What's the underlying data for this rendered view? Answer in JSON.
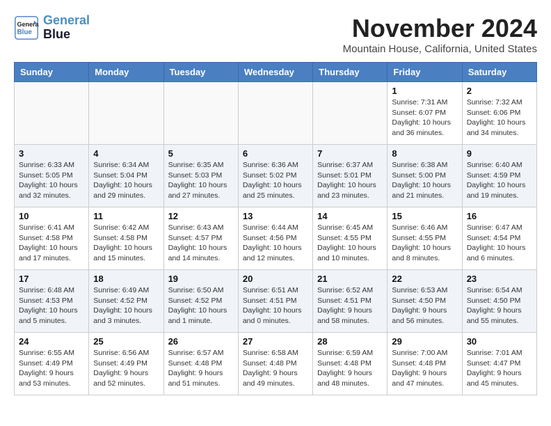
{
  "header": {
    "logo_line1": "General",
    "logo_line2": "Blue",
    "month_year": "November 2024",
    "location": "Mountain House, California, United States"
  },
  "weekdays": [
    "Sunday",
    "Monday",
    "Tuesday",
    "Wednesday",
    "Thursday",
    "Friday",
    "Saturday"
  ],
  "weeks": [
    [
      {
        "day": "",
        "detail": ""
      },
      {
        "day": "",
        "detail": ""
      },
      {
        "day": "",
        "detail": ""
      },
      {
        "day": "",
        "detail": ""
      },
      {
        "day": "",
        "detail": ""
      },
      {
        "day": "1",
        "detail": "Sunrise: 7:31 AM\nSunset: 6:07 PM\nDaylight: 10 hours and 36 minutes."
      },
      {
        "day": "2",
        "detail": "Sunrise: 7:32 AM\nSunset: 6:06 PM\nDaylight: 10 hours and 34 minutes."
      }
    ],
    [
      {
        "day": "3",
        "detail": "Sunrise: 6:33 AM\nSunset: 5:05 PM\nDaylight: 10 hours and 32 minutes."
      },
      {
        "day": "4",
        "detail": "Sunrise: 6:34 AM\nSunset: 5:04 PM\nDaylight: 10 hours and 29 minutes."
      },
      {
        "day": "5",
        "detail": "Sunrise: 6:35 AM\nSunset: 5:03 PM\nDaylight: 10 hours and 27 minutes."
      },
      {
        "day": "6",
        "detail": "Sunrise: 6:36 AM\nSunset: 5:02 PM\nDaylight: 10 hours and 25 minutes."
      },
      {
        "day": "7",
        "detail": "Sunrise: 6:37 AM\nSunset: 5:01 PM\nDaylight: 10 hours and 23 minutes."
      },
      {
        "day": "8",
        "detail": "Sunrise: 6:38 AM\nSunset: 5:00 PM\nDaylight: 10 hours and 21 minutes."
      },
      {
        "day": "9",
        "detail": "Sunrise: 6:40 AM\nSunset: 4:59 PM\nDaylight: 10 hours and 19 minutes."
      }
    ],
    [
      {
        "day": "10",
        "detail": "Sunrise: 6:41 AM\nSunset: 4:58 PM\nDaylight: 10 hours and 17 minutes."
      },
      {
        "day": "11",
        "detail": "Sunrise: 6:42 AM\nSunset: 4:58 PM\nDaylight: 10 hours and 15 minutes."
      },
      {
        "day": "12",
        "detail": "Sunrise: 6:43 AM\nSunset: 4:57 PM\nDaylight: 10 hours and 14 minutes."
      },
      {
        "day": "13",
        "detail": "Sunrise: 6:44 AM\nSunset: 4:56 PM\nDaylight: 10 hours and 12 minutes."
      },
      {
        "day": "14",
        "detail": "Sunrise: 6:45 AM\nSunset: 4:55 PM\nDaylight: 10 hours and 10 minutes."
      },
      {
        "day": "15",
        "detail": "Sunrise: 6:46 AM\nSunset: 4:55 PM\nDaylight: 10 hours and 8 minutes."
      },
      {
        "day": "16",
        "detail": "Sunrise: 6:47 AM\nSunset: 4:54 PM\nDaylight: 10 hours and 6 minutes."
      }
    ],
    [
      {
        "day": "17",
        "detail": "Sunrise: 6:48 AM\nSunset: 4:53 PM\nDaylight: 10 hours and 5 minutes."
      },
      {
        "day": "18",
        "detail": "Sunrise: 6:49 AM\nSunset: 4:52 PM\nDaylight: 10 hours and 3 minutes."
      },
      {
        "day": "19",
        "detail": "Sunrise: 6:50 AM\nSunset: 4:52 PM\nDaylight: 10 hours and 1 minute."
      },
      {
        "day": "20",
        "detail": "Sunrise: 6:51 AM\nSunset: 4:51 PM\nDaylight: 10 hours and 0 minutes."
      },
      {
        "day": "21",
        "detail": "Sunrise: 6:52 AM\nSunset: 4:51 PM\nDaylight: 9 hours and 58 minutes."
      },
      {
        "day": "22",
        "detail": "Sunrise: 6:53 AM\nSunset: 4:50 PM\nDaylight: 9 hours and 56 minutes."
      },
      {
        "day": "23",
        "detail": "Sunrise: 6:54 AM\nSunset: 4:50 PM\nDaylight: 9 hours and 55 minutes."
      }
    ],
    [
      {
        "day": "24",
        "detail": "Sunrise: 6:55 AM\nSunset: 4:49 PM\nDaylight: 9 hours and 53 minutes."
      },
      {
        "day": "25",
        "detail": "Sunrise: 6:56 AM\nSunset: 4:49 PM\nDaylight: 9 hours and 52 minutes."
      },
      {
        "day": "26",
        "detail": "Sunrise: 6:57 AM\nSunset: 4:48 PM\nDaylight: 9 hours and 51 minutes."
      },
      {
        "day": "27",
        "detail": "Sunrise: 6:58 AM\nSunset: 4:48 PM\nDaylight: 9 hours and 49 minutes."
      },
      {
        "day": "28",
        "detail": "Sunrise: 6:59 AM\nSunset: 4:48 PM\nDaylight: 9 hours and 48 minutes."
      },
      {
        "day": "29",
        "detail": "Sunrise: 7:00 AM\nSunset: 4:48 PM\nDaylight: 9 hours and 47 minutes."
      },
      {
        "day": "30",
        "detail": "Sunrise: 7:01 AM\nSunset: 4:47 PM\nDaylight: 9 hours and 45 minutes."
      }
    ]
  ]
}
